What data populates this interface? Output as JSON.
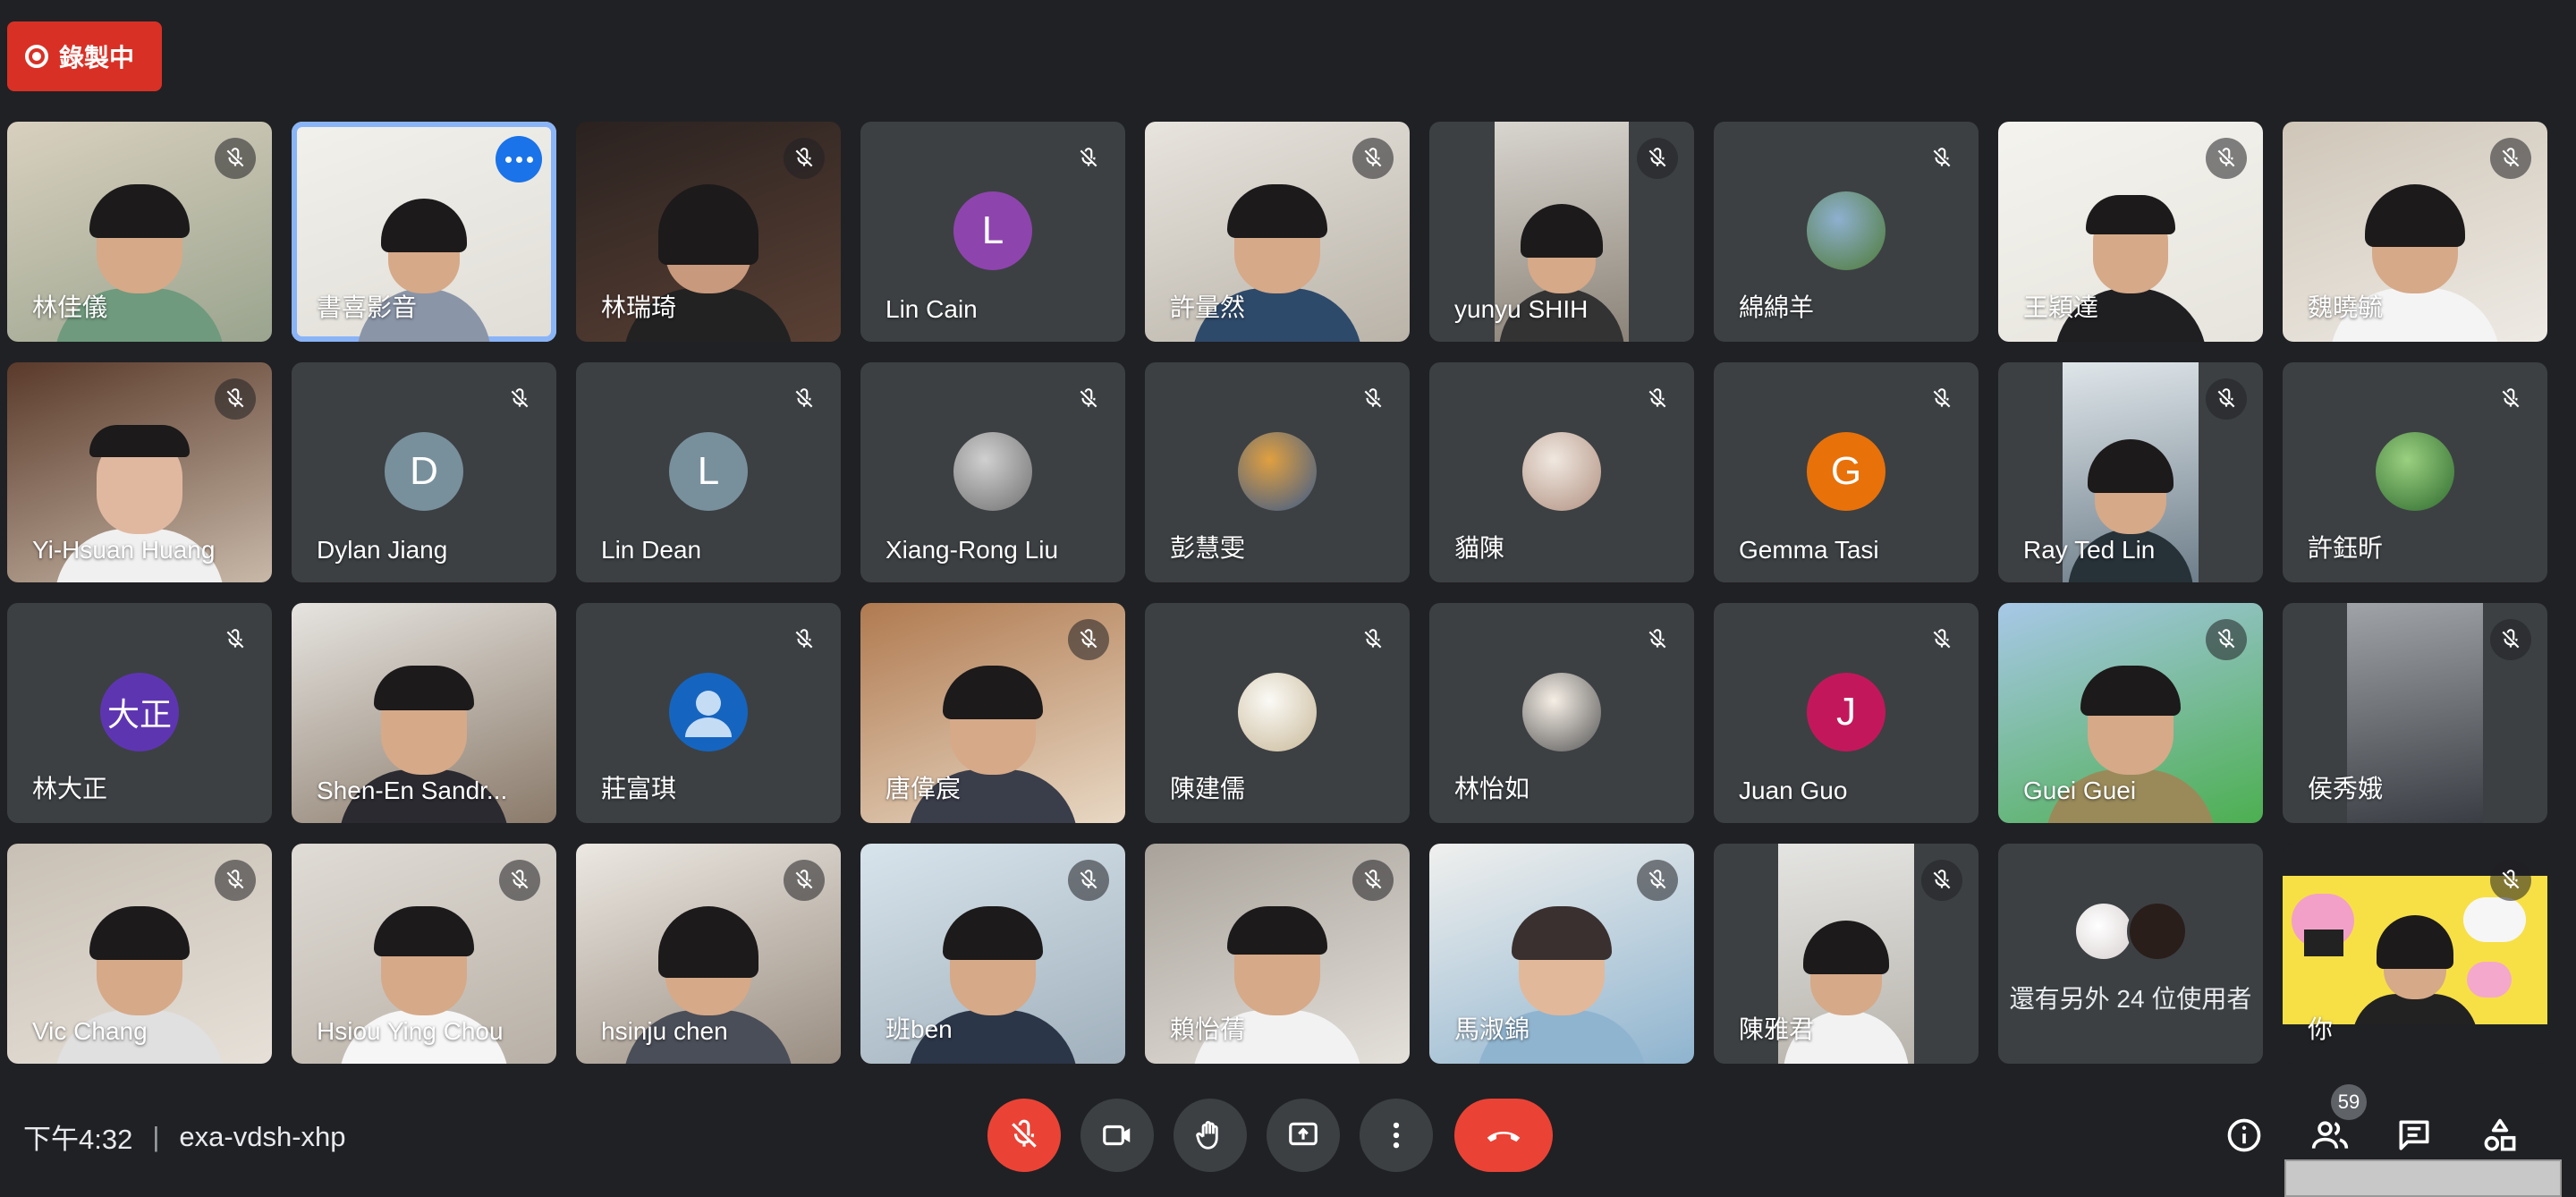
{
  "recording": {
    "label": "錄製中"
  },
  "tiles": [
    {
      "name": "林佳儀"
    },
    {
      "name": "書喜影音"
    },
    {
      "name": "林瑞琦"
    },
    {
      "name": "Lin Cain",
      "initial": "L"
    },
    {
      "name": "許量然"
    },
    {
      "name": "yunyu SHIH"
    },
    {
      "name": "綿綿羊"
    },
    {
      "name": "王穎達"
    },
    {
      "name": "魏曉毓"
    },
    {
      "name": "Yi-Hsuan Huang"
    },
    {
      "name": "Dylan Jiang",
      "initial": "D"
    },
    {
      "name": "Lin Dean",
      "initial": "L"
    },
    {
      "name": "Xiang-Rong Liu"
    },
    {
      "name": "彭慧雯"
    },
    {
      "name": "貓陳"
    },
    {
      "name": "Gemma Tasi",
      "initial": "G"
    },
    {
      "name": "Ray Ted Lin"
    },
    {
      "name": "許鈺昕"
    },
    {
      "name": "林大正",
      "initial": "大正"
    },
    {
      "name": "Shen-En Sandr..."
    },
    {
      "name": "莊富琪"
    },
    {
      "name": "唐偉宸"
    },
    {
      "name": "陳建儒"
    },
    {
      "name": "林怡如"
    },
    {
      "name": "Juan Guo",
      "initial": "J"
    },
    {
      "name": "Guei Guei"
    },
    {
      "name": "侯秀娥"
    },
    {
      "name": "Vic Chang"
    },
    {
      "name": "Hsiou Ying Chou"
    },
    {
      "name": "hsinju chen"
    },
    {
      "name": "班ben"
    },
    {
      "name": "賴怡蒨"
    },
    {
      "name": "馬淑錦"
    },
    {
      "name": "陳雅君"
    },
    {
      "name": "還有另外 24 位使用者"
    },
    {
      "name": "你"
    }
  ],
  "meeting": {
    "time": "下午4:32",
    "code": "exa-vdsh-xhp"
  },
  "participants_count": "59",
  "colors": {
    "background": "#202124",
    "tile": "#3c4043",
    "danger": "#ea4335",
    "recording": "#d93025",
    "selected": "#8ab4f8"
  }
}
